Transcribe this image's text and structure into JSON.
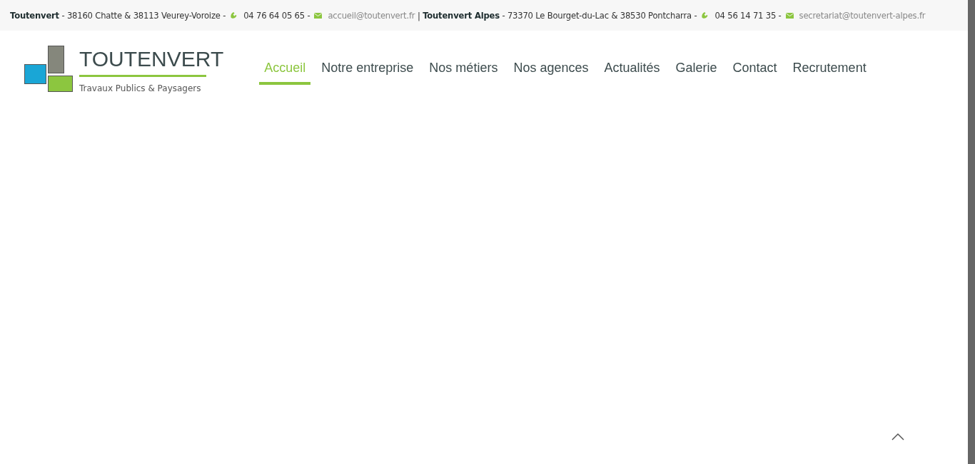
{
  "top_bar": {
    "agencies": [
      {
        "name": "Toutenvert",
        "address": "- 38160 Chatte & 38113 Veurey-Voroize -",
        "phone": "04 76 64 05 65 -",
        "email": "accueil@toutenvert.fr"
      },
      {
        "name": "Toutenvert Alpes",
        "address": "- 73370 Le Bourget-du-Lac & 38530 Pontcharra -",
        "phone": "04 56 14 71 35 -",
        "email": "secretariat@toutenvert-alpes.fr"
      }
    ],
    "separator": "|"
  },
  "logo": {
    "title": "TOUTENVERT",
    "subtitle": "Travaux Publics & Paysagers"
  },
  "nav": [
    {
      "label": "Accueil",
      "selected": true
    },
    {
      "label": "Notre entreprise",
      "selected": false
    },
    {
      "label": "Nos métiers",
      "selected": false
    },
    {
      "label": "Nos agences",
      "selected": false
    },
    {
      "label": "Actualités",
      "selected": false
    },
    {
      "label": "Galerie",
      "selected": false
    },
    {
      "label": "Contact",
      "selected": false
    },
    {
      "label": "Recrutement",
      "selected": false
    }
  ]
}
